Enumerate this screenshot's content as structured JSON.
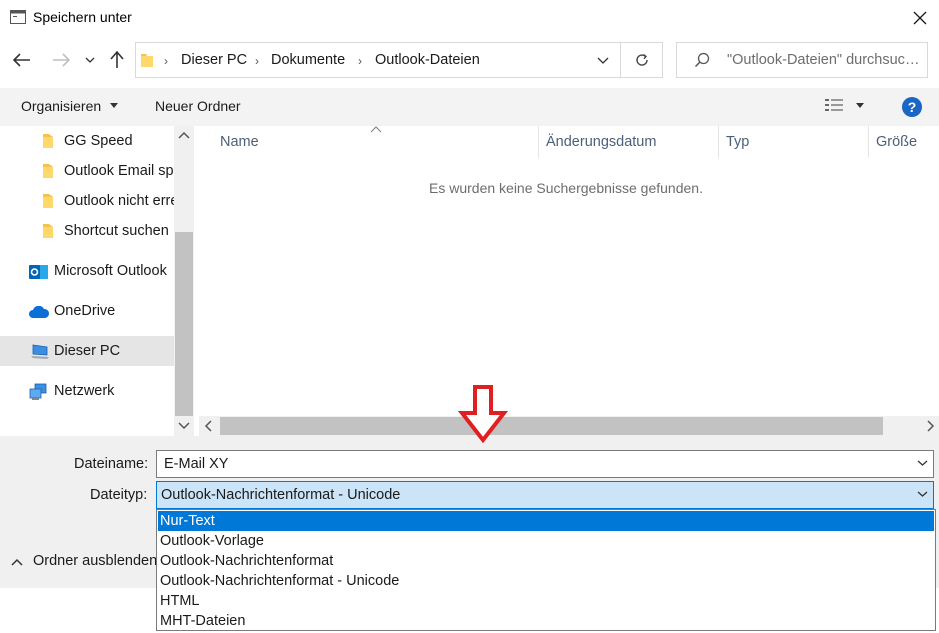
{
  "window": {
    "title": "Speichern unter"
  },
  "address": {
    "crumbs": [
      "Dieser PC",
      "Dokumente",
      "Outlook-Dateien"
    ],
    "search_placeholder": "\"Outlook-Dateien\" durchsuchen"
  },
  "toolbar": {
    "organize_label": "Organisieren",
    "new_folder_label": "Neuer Ordner",
    "help_label": "?"
  },
  "nav": {
    "items": [
      {
        "label": "GG Speed",
        "icon": "folder-icon"
      },
      {
        "label": "Outlook Email speichern",
        "icon": "folder-icon"
      },
      {
        "label": "Outlook nicht erreichbar",
        "icon": "folder-icon"
      },
      {
        "label": "Shortcut suchen",
        "icon": "folder-icon"
      },
      {
        "label": "Microsoft Outlook",
        "icon": "outlook-icon"
      },
      {
        "label": "OneDrive",
        "icon": "onedrive-icon"
      },
      {
        "label": "Dieser PC",
        "icon": "computer-icon",
        "selected": true
      },
      {
        "label": "Netzwerk",
        "icon": "network-icon"
      }
    ]
  },
  "filelist": {
    "columns": [
      "Name",
      "Änderungsdatum",
      "Typ",
      "Größe"
    ],
    "empty_message": "Es wurden keine Suchergebnisse gefunden."
  },
  "form": {
    "filename_label": "Dateiname:",
    "filename_value": "E-Mail XY",
    "filetype_label": "Dateityp:",
    "filetype_value": "Outlook-Nachrichtenformat - Unicode",
    "filetype_options": [
      "Nur-Text",
      "Outlook-Vorlage",
      "Outlook-Nachrichtenformat",
      "Outlook-Nachrichtenformat - Unicode",
      "HTML",
      "MHT-Dateien"
    ],
    "highlighted_option": "Nur-Text",
    "hide_folders_label": "Ordner ausblenden"
  },
  "colors": {
    "accent": "#0078d7",
    "annotation": "#e02020",
    "select_bg": "#cce4f7"
  }
}
